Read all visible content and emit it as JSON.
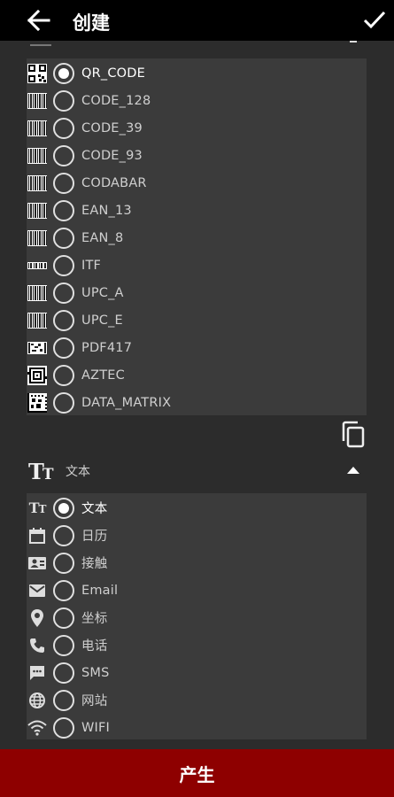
{
  "header": {
    "title": "创建"
  },
  "barcode_types": [
    {
      "label": "QR_CODE",
      "icon": "qr-code-icon",
      "selected": true
    },
    {
      "label": "CODE_128",
      "icon": "barcode-icon",
      "selected": false
    },
    {
      "label": "CODE_39",
      "icon": "barcode-icon",
      "selected": false
    },
    {
      "label": "CODE_93",
      "icon": "barcode-icon",
      "selected": false
    },
    {
      "label": "CODABAR",
      "icon": "barcode-icon",
      "selected": false
    },
    {
      "label": "EAN_13",
      "icon": "barcode-icon",
      "selected": false
    },
    {
      "label": "EAN_8",
      "icon": "barcode-icon",
      "selected": false
    },
    {
      "label": "ITF",
      "icon": "itf-barcode-icon",
      "selected": false
    },
    {
      "label": "UPC_A",
      "icon": "barcode-icon",
      "selected": false
    },
    {
      "label": "UPC_E",
      "icon": "barcode-icon",
      "selected": false
    },
    {
      "label": "PDF417",
      "icon": "pdf417-icon",
      "selected": false
    },
    {
      "label": "AZTEC",
      "icon": "aztec-icon",
      "selected": false
    },
    {
      "label": "DATA_MATRIX",
      "icon": "data-matrix-icon",
      "selected": false
    }
  ],
  "content_section": {
    "label": "文本"
  },
  "content_types": [
    {
      "label": "文本",
      "icon": "text-icon",
      "selected": true
    },
    {
      "label": "日历",
      "icon": "calendar-icon",
      "selected": false
    },
    {
      "label": "接触",
      "icon": "contact-icon",
      "selected": false
    },
    {
      "label": "Email",
      "icon": "email-icon",
      "selected": false
    },
    {
      "label": "坐标",
      "icon": "location-icon",
      "selected": false
    },
    {
      "label": "电话",
      "icon": "phone-icon",
      "selected": false
    },
    {
      "label": "SMS",
      "icon": "sms-icon",
      "selected": false
    },
    {
      "label": "网站",
      "icon": "globe-icon",
      "selected": false
    },
    {
      "label": "WIFI",
      "icon": "wifi-icon",
      "selected": false
    }
  ],
  "footer": {
    "generate_label": "产生"
  },
  "colors": {
    "topbar": "#000000",
    "background": "#2c2c2c",
    "panel": "#3b3b3b",
    "button": "#8e0000"
  }
}
